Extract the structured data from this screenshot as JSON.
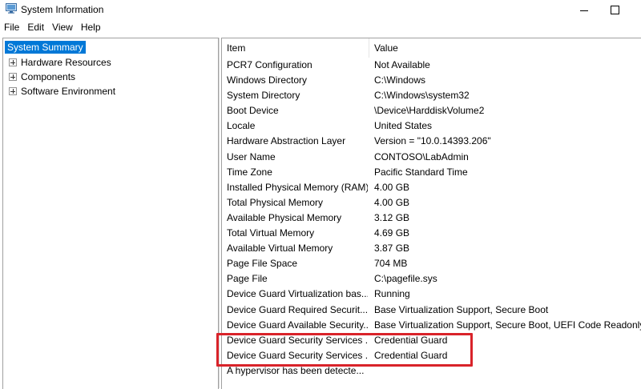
{
  "window": {
    "title": "System Information"
  },
  "menu": [
    "File",
    "Edit",
    "View",
    "Help"
  ],
  "tree": {
    "root": "System Summary",
    "children": [
      "Hardware Resources",
      "Components",
      "Software Environment"
    ]
  },
  "table": {
    "columns": [
      "Item",
      "Value"
    ],
    "rows": [
      {
        "item": "PCR7 Configuration",
        "value": "Not Available"
      },
      {
        "item": "Windows Directory",
        "value": "C:\\Windows"
      },
      {
        "item": "System Directory",
        "value": "C:\\Windows\\system32"
      },
      {
        "item": "Boot Device",
        "value": "\\Device\\HarddiskVolume2"
      },
      {
        "item": "Locale",
        "value": "United States"
      },
      {
        "item": "Hardware Abstraction Layer",
        "value": "Version = \"10.0.14393.206\""
      },
      {
        "item": "User Name",
        "value": "CONTOSO\\LabAdmin"
      },
      {
        "item": "Time Zone",
        "value": "Pacific Standard Time"
      },
      {
        "item": "Installed Physical Memory (RAM)",
        "value": "4.00 GB"
      },
      {
        "item": "Total Physical Memory",
        "value": "4.00 GB"
      },
      {
        "item": "Available Physical Memory",
        "value": "3.12 GB"
      },
      {
        "item": "Total Virtual Memory",
        "value": "4.69 GB"
      },
      {
        "item": "Available Virtual Memory",
        "value": "3.87 GB"
      },
      {
        "item": "Page File Space",
        "value": "704 MB"
      },
      {
        "item": "Page File",
        "value": "C:\\pagefile.sys"
      },
      {
        "item": "Device Guard Virtualization bas...",
        "value": "Running"
      },
      {
        "item": "Device Guard Required Securit...",
        "value": "Base Virtualization Support, Secure Boot"
      },
      {
        "item": "Device Guard Available Security...",
        "value": "Base Virtualization Support, Secure Boot, UEFI Code Readonly"
      },
      {
        "item": "Device Guard Security Services ...",
        "value": "Credential Guard"
      },
      {
        "item": "Device Guard Security Services ...",
        "value": "Credential Guard"
      },
      {
        "item": "A hypervisor has been detecte...",
        "value": ""
      }
    ]
  },
  "colors": {
    "selection": "#0078d7",
    "highlight_border": "#d9232a"
  },
  "icons": {
    "app": "system-information-icon",
    "minimize": "minimize-icon",
    "maximize": "maximize-icon",
    "expand": "plus-expander-icon"
  }
}
